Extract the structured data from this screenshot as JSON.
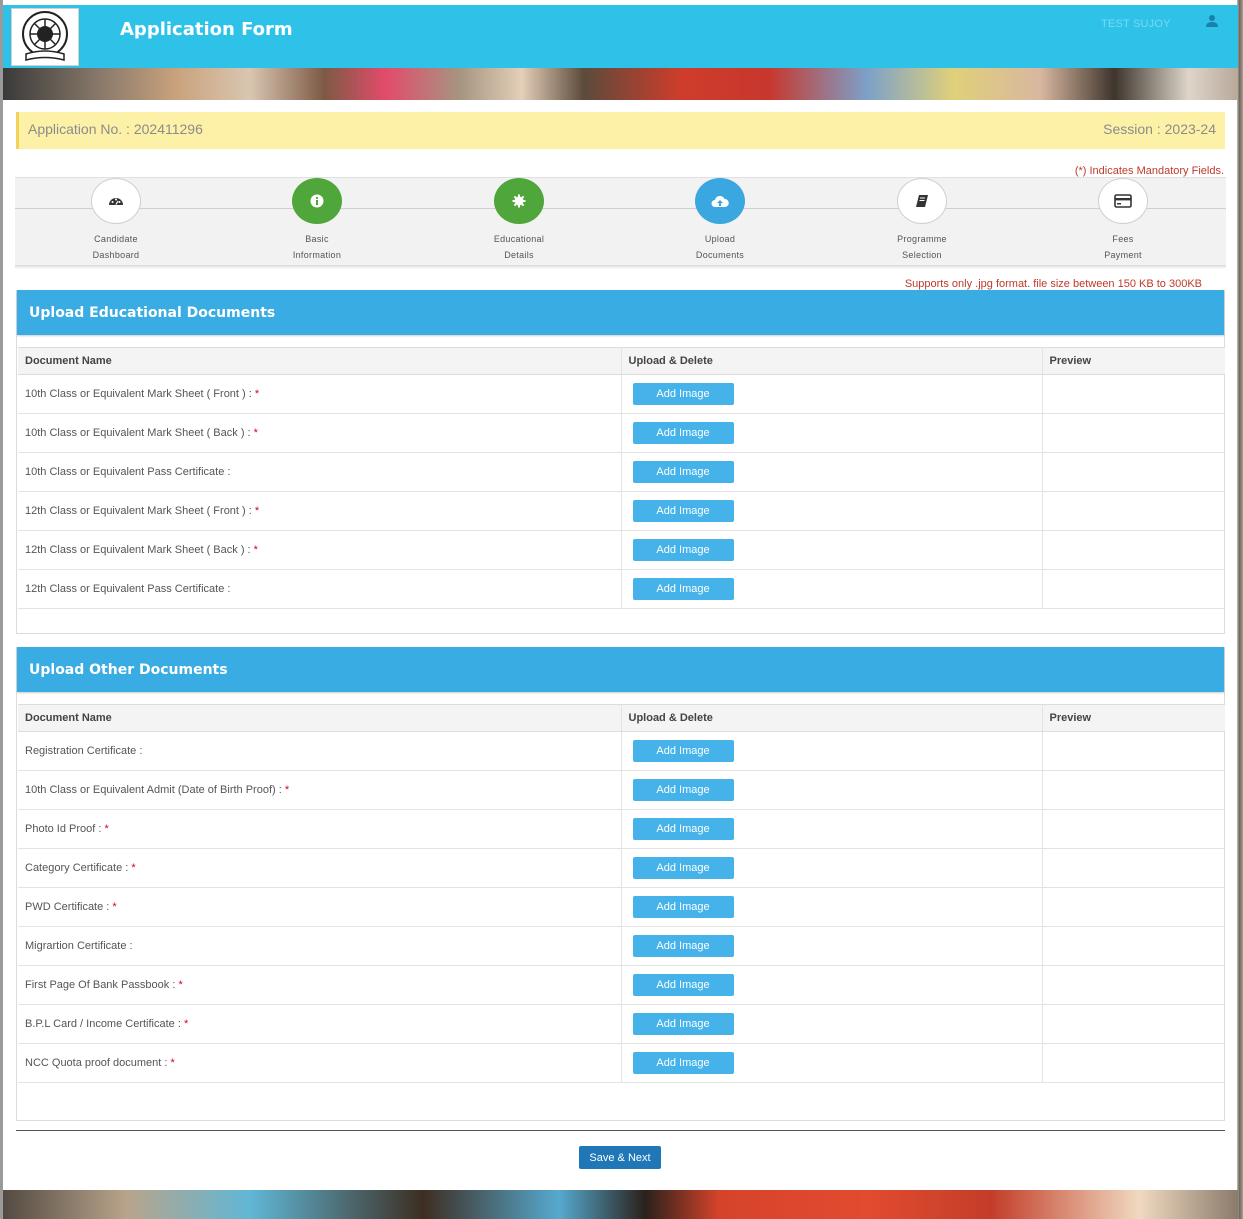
{
  "header": {
    "title": "Application Form",
    "user_name": "TEST SUJOY"
  },
  "application": {
    "number_label": "Application No. : 202411296",
    "session_label": "Session : 2023-24"
  },
  "mandatory_note": "(*) Indicates Mandatory Fields.",
  "steps": [
    {
      "line1": "Candidate",
      "line2": "Dashboard",
      "icon": "dashboard-icon",
      "state": "pending"
    },
    {
      "line1": "Basic",
      "line2": "Information",
      "icon": "info-icon",
      "state": "done"
    },
    {
      "line1": "Educational",
      "line2": "Details",
      "icon": "gear-icon",
      "state": "done"
    },
    {
      "line1": "Upload",
      "line2": "Documents",
      "icon": "cloud-upload-icon",
      "state": "active"
    },
    {
      "line1": "Programme",
      "line2": "Selection",
      "icon": "book-icon",
      "state": "pending"
    },
    {
      "line1": "Fees",
      "line2": "Payment",
      "icon": "credit-card-icon",
      "state": "pending"
    }
  ],
  "support_note": "Supports only .jpg format.  file size between 150 KB to 300KB",
  "table_headers": {
    "name": "Document Name",
    "upload": "Upload  &  Delete",
    "preview": "Preview"
  },
  "add_image_label": "Add Image",
  "educational": {
    "title": "Upload Educational Documents",
    "rows": [
      {
        "name": "10th Class or Equivalent  Mark Sheet ( Front )  : ",
        "required": true
      },
      {
        "name": "10th Class or Equivalent  Mark Sheet ( Back )  : ",
        "required": true
      },
      {
        "name": "10th Class or Equivalent Pass Certificate   : ",
        "required": false
      },
      {
        "name": "12th Class or Equivalent  Mark Sheet ( Front )  : ",
        "required": true
      },
      {
        "name": "12th Class or Equivalent  Mark Sheet ( Back )  : ",
        "required": true
      },
      {
        "name": "12th Class or Equivalent Pass Certificate   : ",
        "required": false
      }
    ]
  },
  "other": {
    "title": "Upload Other Documents",
    "rows": [
      {
        "name": "Registration Certificate  : ",
        "required": false
      },
      {
        "name": "10th Class or Equivalent Admit (Date of Birth Proof)  : ",
        "required": true
      },
      {
        "name": "Photo Id Proof  : ",
        "required": true
      },
      {
        "name": "Category Certificate  : ",
        "required": true
      },
      {
        "name": "PWD Certificate  : ",
        "required": true
      },
      {
        "name": "Migrartion Certificate  : ",
        "required": false
      },
      {
        "name": "First Page Of Bank Passbook  : ",
        "required": true
      },
      {
        "name": "B.P.L Card / Income Certificate  : ",
        "required": true
      },
      {
        "name": "NCC Quota proof document  : ",
        "required": true
      }
    ]
  },
  "save_label": "Save & Next",
  "colors": {
    "header_bg": "#2ec2e8",
    "panel_head": "#39ace3",
    "step_done": "#4fa63a",
    "step_active": "#3aa7e0",
    "button": "#45b2ea",
    "save_button": "#1f77b8",
    "app_bar": "#fdf1a8",
    "required": "#d0021b"
  }
}
